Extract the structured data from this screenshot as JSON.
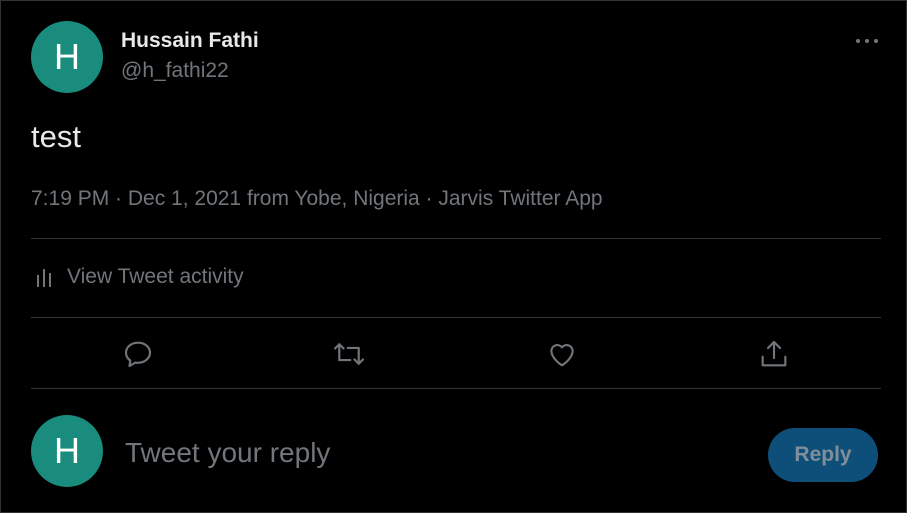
{
  "author": {
    "avatar_initial": "H",
    "display_name": "Hussain Fathi",
    "handle": "@h_fathi22"
  },
  "tweet": {
    "text": "test",
    "meta": "7:19 PM · Dec 1, 2021 from Yobe, Nigeria · Jarvis Twitter App"
  },
  "activity": {
    "label": "View Tweet activity"
  },
  "actions": {
    "icons": [
      "reply-icon",
      "retweet-icon",
      "like-icon",
      "share-icon"
    ]
  },
  "reply_box": {
    "avatar_initial": "H",
    "placeholder": "Tweet your reply",
    "button_label": "Reply"
  },
  "colors": {
    "background": "#000000",
    "avatar": "#1a8c7e",
    "muted_text": "#71767b",
    "primary_text": "#e7e9ea",
    "divider": "#2f3336",
    "reply_button_disabled": "#0e4f7a"
  }
}
